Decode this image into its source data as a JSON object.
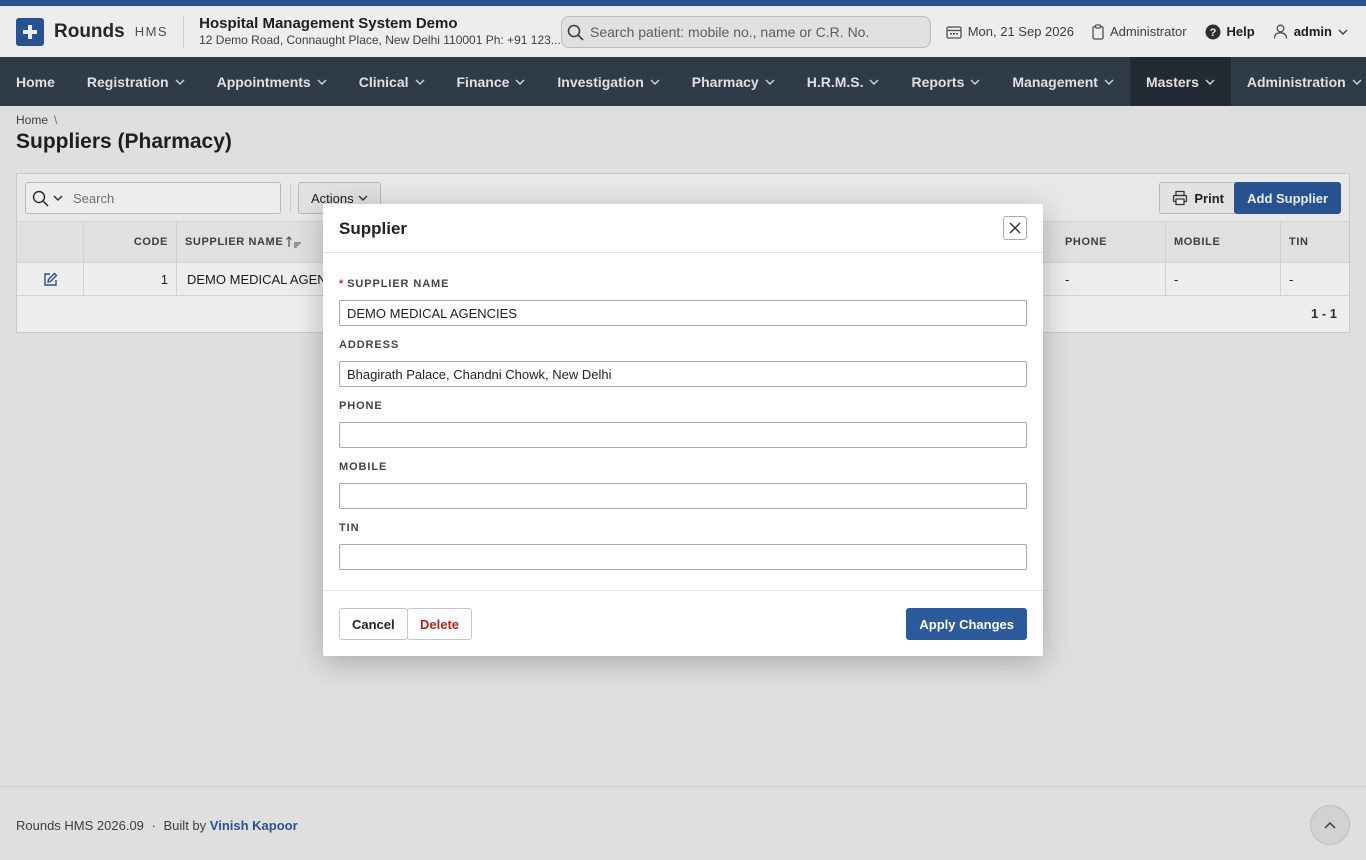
{
  "header": {
    "logo_name": "Rounds",
    "logo_tag": "HMS",
    "org_name": "Hospital Management System Demo",
    "org_address": "12 Demo Road, Connaught Place, New Delhi 110001 Ph: +91 123...",
    "search_placeholder": "Search patient: mobile no., name or C.R. No.",
    "date": "Mon, 21 Sep 2026",
    "role": "Administrator",
    "help": "Help",
    "user": "admin"
  },
  "nav": {
    "items": [
      {
        "label": "Home"
      },
      {
        "label": "Registration"
      },
      {
        "label": "Appointments"
      },
      {
        "label": "Clinical"
      },
      {
        "label": "Finance"
      },
      {
        "label": "Investigation"
      },
      {
        "label": "Pharmacy"
      },
      {
        "label": "H.R.M.S."
      },
      {
        "label": "Reports"
      },
      {
        "label": "Management"
      },
      {
        "label": "Masters"
      },
      {
        "label": "Administration"
      }
    ],
    "active": "Masters"
  },
  "breadcrumb": {
    "home": "Home",
    "separator": "\\"
  },
  "page_title": "Suppliers (Pharmacy)",
  "toolbar": {
    "search_placeholder": "Search",
    "actions_label": "Actions",
    "print_label": "Print",
    "add_label": "Add Supplier"
  },
  "grid": {
    "columns": {
      "code": "CODE",
      "supplier_name": "SUPPLIER NAME",
      "phone": "PHONE",
      "mobile": "MOBILE",
      "tin": "TIN"
    },
    "rows": [
      {
        "code": "1",
        "supplier_name": "DEMO MEDICAL AGEN",
        "phone": "-",
        "mobile": "-",
        "tin": "-"
      }
    ],
    "pagination": "1 - 1"
  },
  "dialog": {
    "title": "Supplier",
    "fields": {
      "supplier_name": {
        "label": "SUPPLIER NAME",
        "required": "*",
        "value": "DEMO MEDICAL AGENCIES"
      },
      "address": {
        "label": "ADDRESS",
        "value": "Bhagirath Palace, Chandni Chowk, New Delhi"
      },
      "phone": {
        "label": "PHONE",
        "value": ""
      },
      "mobile": {
        "label": "MOBILE",
        "value": ""
      },
      "tin": {
        "label": "TIN",
        "value": ""
      }
    },
    "cancel_label": "Cancel",
    "delete_label": "Delete",
    "apply_label": "Apply Changes"
  },
  "footer": {
    "version": "Rounds HMS 2026.09",
    "dot": "·",
    "built_by": "Built by",
    "author": "Vinish Kapoor"
  },
  "colors": {
    "brand": "#2d5a9b",
    "nav_bg": "#33404d",
    "nav_active": "#252e38",
    "danger": "#b5241c"
  }
}
